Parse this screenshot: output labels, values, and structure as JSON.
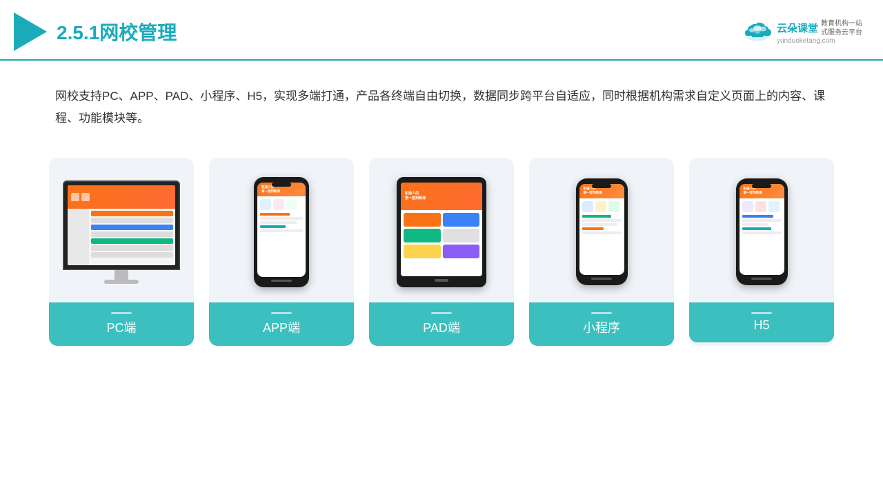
{
  "header": {
    "section_number": "2.5.1",
    "title_plain": "网校管理",
    "brand_name": "云朵课堂",
    "brand_url": "yunduoketang.com",
    "brand_slogan": "教育机构一站\n式服务云平台"
  },
  "description": {
    "text": "网校支持PC、APP、PAD、小程序、H5，实现多端打通，产品各终端自由切换，数据同步跨平台自适应，同时根据机构需求自定义页面上的内容、课程、功能模块等。"
  },
  "cards": [
    {
      "id": "pc",
      "label": "PC端"
    },
    {
      "id": "app",
      "label": "APP端"
    },
    {
      "id": "pad",
      "label": "PAD端"
    },
    {
      "id": "miniprogram",
      "label": "小程序"
    },
    {
      "id": "h5",
      "label": "H5"
    }
  ],
  "colors": {
    "accent": "#1AABBB",
    "card_bg": "#eef2f7",
    "label_bg": "#3bbfbf",
    "orange": "#f97316",
    "dark": "#1a1a1a"
  }
}
